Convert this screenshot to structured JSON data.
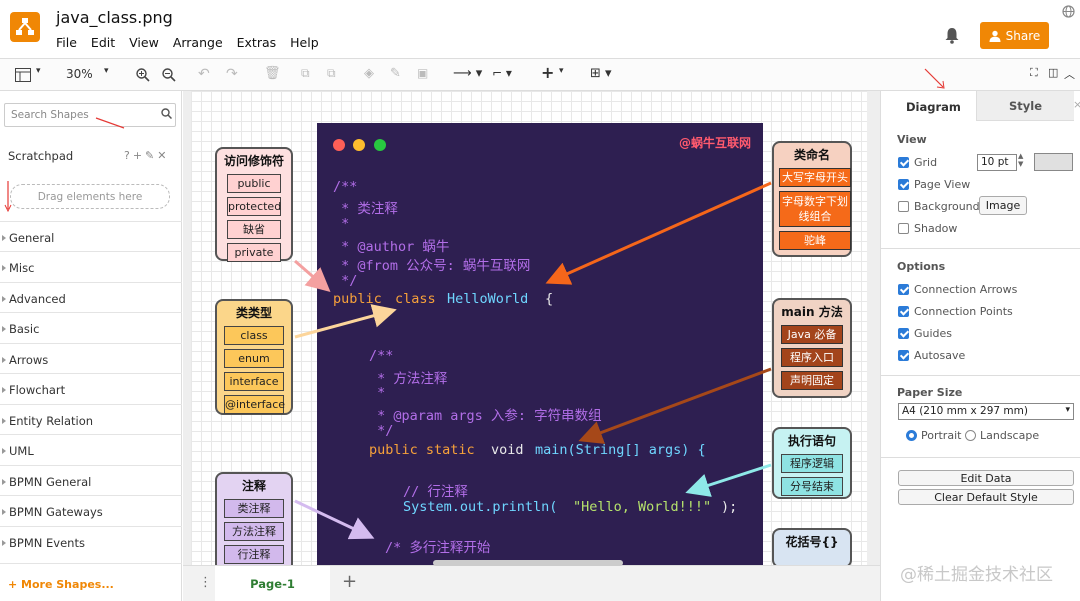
{
  "app": {
    "file_name": "java_class.png",
    "menu": [
      "File",
      "Edit",
      "View",
      "Arrange",
      "Extras",
      "Help"
    ],
    "share_label": "Share",
    "accent": "#f08705"
  },
  "toolbar": {
    "zoom": "30%"
  },
  "left_panel": {
    "search_placeholder": "Search Shapes",
    "scratchpad": "Scratchpad",
    "scratchpad_tools": "?+✎✕",
    "drop_hint": "Drag elements here",
    "categories": [
      "General",
      "Misc",
      "Advanced",
      "Basic",
      "Arrows",
      "Flowchart",
      "Entity Relation",
      "UML",
      "BPMN General",
      "BPMN Gateways",
      "BPMN Events"
    ],
    "more_shapes": "+ More Shapes..."
  },
  "canvas": {
    "brand": "@蜗牛互联网",
    "code_lines": [
      "/**",
      " * 类注释",
      " *",
      " * @author 蜗牛",
      " * @from 公众号: 蜗牛互联网",
      " */",
      "public",
      "class",
      "HelloWorld",
      "{",
      "/**",
      " * 方法注释",
      " *",
      " * @param args 入参: 字符串数组",
      " */",
      "public static",
      "void",
      "main(String[] args) {",
      "// 行注释",
      "System.out.println(",
      "\"Hello, World!!!\"",
      ");",
      "/* 多行注释开始"
    ],
    "boxes": {
      "access": {
        "title": "访问修饰符",
        "items": [
          "public",
          "protected",
          "缺省",
          "private"
        ]
      },
      "class_type": {
        "title": "类类型",
        "items": [
          "class",
          "enum",
          "interface",
          "@interface"
        ]
      },
      "comment": {
        "title": "注释",
        "items": [
          "类注释",
          "方法注释",
          "行注释"
        ]
      },
      "naming": {
        "title": "类命名",
        "items": [
          "大写字母开头",
          "字母数字下划线组合",
          "驼峰"
        ]
      },
      "main": {
        "title": "main 方法",
        "items": [
          "Java 必备",
          "程序入口",
          "声明固定"
        ]
      },
      "exec": {
        "title": "执行语句",
        "items": [
          "程序逻辑",
          "分号结束"
        ]
      },
      "brace": {
        "title": "花括号{}"
      }
    }
  },
  "bottom": {
    "page_tab": "Page-1",
    "add": "+"
  },
  "right_panel": {
    "tab_diagram": "Diagram",
    "tab_style": "Style",
    "view_label": "View",
    "grid_label": "Grid",
    "grid_size": "10 pt",
    "page_view": "Page View",
    "background": "Background",
    "image_button": "Image",
    "shadow": "Shadow",
    "options_label": "Options",
    "connection_arrows": "Connection Arrows",
    "connection_points": "Connection Points",
    "guides": "Guides",
    "autosave": "Autosave",
    "paper_size_label": "Paper Size",
    "paper_size": "A4 (210 mm x 297 mm)",
    "portrait": "Portrait",
    "landscape": "Landscape",
    "edit_data": "Edit Data",
    "clear_style": "Clear Default Style"
  },
  "watermark": "@稀土掘金技术社区"
}
